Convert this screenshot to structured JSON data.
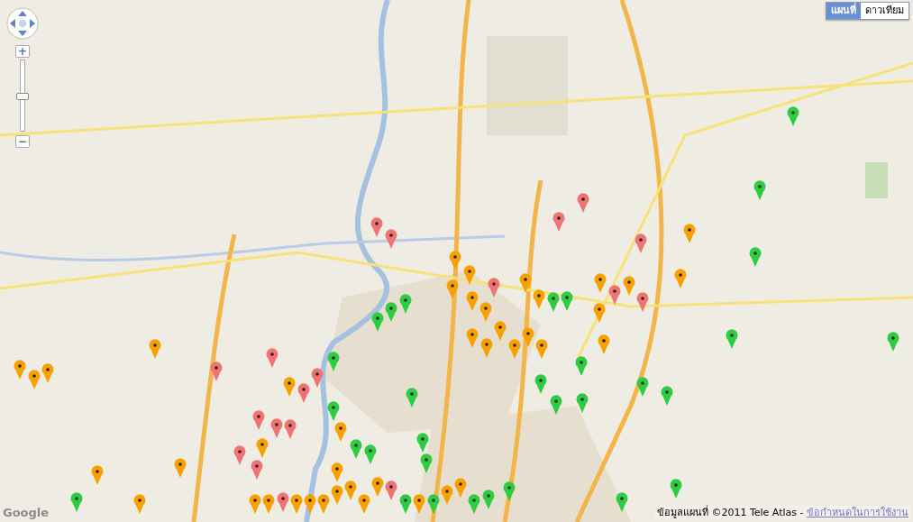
{
  "map_type_buttons": [
    {
      "label": "แผนที่",
      "selected": true
    },
    {
      "label": "ดาวเทียม",
      "selected": false
    }
  ],
  "zoom": {
    "plus": "+",
    "minus": "−",
    "level": 0.5
  },
  "markers": [
    {
      "color": "#2ecc40"
    },
    {
      "color": "#2ecc40"
    },
    {
      "color": "#2ecc40"
    },
    {
      "color": "#2ecc40"
    },
    {
      "color": "#2ecc40"
    },
    {
      "color": "#2ecc40"
    },
    {
      "color": "#2ecc40"
    },
    {
      "color": "#2ecc40"
    },
    {
      "color": "#2ecc40"
    },
    {
      "color": "#2ecc40"
    },
    {
      "color": "#2ecc40"
    },
    {
      "color": "#2ecc40"
    },
    {
      "color": "#2ecc40"
    },
    {
      "color": "#2ecc40"
    },
    {
      "color": "#2ecc40"
    },
    {
      "color": "#2ecc40"
    },
    {
      "color": "#2ecc40"
    },
    {
      "color": "#2ecc40"
    },
    {
      "color": "#2ecc40"
    },
    {
      "color": "#2ecc40"
    },
    {
      "color": "#2ecc40"
    },
    {
      "color": "#2ecc40"
    },
    {
      "color": "#2ecc40"
    },
    {
      "color": "#2ecc40"
    },
    {
      "color": "#2ecc40"
    },
    {
      "color": "#2ecc40"
    },
    {
      "color": "#2ecc40"
    },
    {
      "color": "#2ecc40"
    },
    {
      "color": "#2ecc40"
    },
    {
      "color": "#2ecc40"
    },
    {
      "color": "#2ecc40"
    },
    {
      "color": "#f07272"
    },
    {
      "color": "#f07272"
    },
    {
      "color": "#f07272"
    },
    {
      "color": "#f07272"
    },
    {
      "color": "#f07272"
    },
    {
      "color": "#f07272"
    },
    {
      "color": "#f07272"
    },
    {
      "color": "#f07272"
    },
    {
      "color": "#f07272"
    },
    {
      "color": "#f07272"
    },
    {
      "color": "#f07272"
    },
    {
      "color": "#f07272"
    },
    {
      "color": "#f07272"
    },
    {
      "color": "#f07272"
    },
    {
      "color": "#f07272"
    },
    {
      "color": "#f07272"
    },
    {
      "color": "#f07272"
    },
    {
      "color": "#f07272"
    },
    {
      "color": "#f07272"
    },
    {
      "color": "#f7a000"
    },
    {
      "color": "#f7a000"
    },
    {
      "color": "#f7a000"
    },
    {
      "color": "#f7a000"
    },
    {
      "color": "#f7a000"
    },
    {
      "color": "#f7a000"
    },
    {
      "color": "#f7a000"
    },
    {
      "color": "#f7a000"
    },
    {
      "color": "#f7a000"
    },
    {
      "color": "#f7a000"
    },
    {
      "color": "#f7a000"
    },
    {
      "color": "#f7a000"
    },
    {
      "color": "#f7a000"
    },
    {
      "color": "#f7a000"
    },
    {
      "color": "#f7a000"
    },
    {
      "color": "#f7a000"
    },
    {
      "color": "#f7a000"
    },
    {
      "color": "#f7a000"
    },
    {
      "color": "#f7a000"
    },
    {
      "color": "#f7a000"
    },
    {
      "color": "#f7a000"
    },
    {
      "color": "#f7a000"
    },
    {
      "color": "#f7a000"
    },
    {
      "color": "#f7a000"
    },
    {
      "color": "#f7a000"
    },
    {
      "color": "#f7a000"
    },
    {
      "color": "#f7a000"
    },
    {
      "color": "#f7a000"
    },
    {
      "color": "#f7a000"
    },
    {
      "color": "#f7a000"
    },
    {
      "color": "#f7a000"
    },
    {
      "color": "#f7a000"
    },
    {
      "color": "#f7a000"
    },
    {
      "color": "#f7a000"
    },
    {
      "color": "#f7a000"
    },
    {
      "color": "#f7a000"
    },
    {
      "color": "#f7a000"
    },
    {
      "color": "#f7a000"
    },
    {
      "color": "#f7a000"
    },
    {
      "color": "#f7a000"
    },
    {
      "color": "#f7a000"
    },
    {
      "color": "#f7a000"
    }
  ],
  "logo": "Google",
  "attribution": {
    "text": "ข้อมูลแผนที่ ©2011 Tele Atlas - ",
    "link": "ข้อกำหนดในการใช้งาน"
  }
}
